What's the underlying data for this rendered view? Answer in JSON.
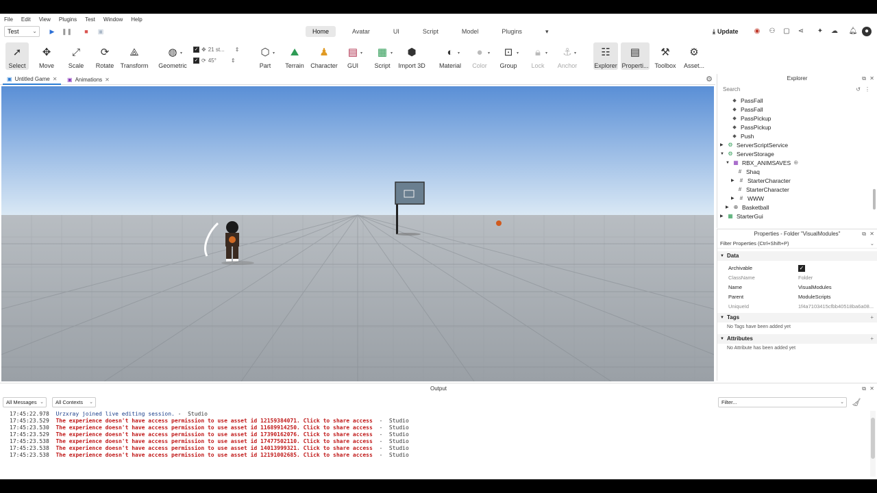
{
  "menu": [
    "File",
    "Edit",
    "View",
    "Plugins",
    "Test",
    "Window",
    "Help"
  ],
  "mode_select": "Test",
  "ribbon_tabs": [
    "Home",
    "Avatar",
    "UI",
    "Script",
    "Model",
    "Plugins"
  ],
  "ribbon_more": "▾",
  "update_label": "Update",
  "toolbar": {
    "select": "Select",
    "move": "Move",
    "scale": "Scale",
    "rotate": "Rotate",
    "transform": "Transform",
    "geometric": "Geometric",
    "snap_move": "21 st...",
    "snap_rotate": "45°",
    "part": "Part",
    "terrain": "Terrain",
    "character": "Character",
    "gui": "GUI",
    "script": "Script",
    "import3d": "Import 3D",
    "material": "Material",
    "color": "Color",
    "group": "Group",
    "lock": "Lock",
    "anchor": "Anchor",
    "explorer": "Explorer",
    "properties": "Properti...",
    "toolbox": "Toolbox",
    "asset": "Asset..."
  },
  "doc_tabs": [
    "Untitled Game",
    "Animations"
  ],
  "explorer": {
    "title": "Explorer",
    "search_placeholder": "Search",
    "items": [
      "PassFall",
      "PassFall",
      "PassPickup",
      "PassPickup",
      "Push",
      "ServerScriptService",
      "ServerStorage",
      "RBX_ANIMSAVES",
      "Shaq",
      "StarterCharacter",
      "StarterCharacter",
      "WWW",
      "Basketball",
      "StarterGui"
    ]
  },
  "properties": {
    "title": "Properties - Folder \"VisualModules\"",
    "filter": "Filter Properties (Ctrl+Shift+P)",
    "section_data": "Data",
    "rows": [
      {
        "name": "Archivable",
        "value": ""
      },
      {
        "name": "ClassName",
        "value": "Folder"
      },
      {
        "name": "Name",
        "value": "VisualModules"
      },
      {
        "name": "Parent",
        "value": "ModuleScripts"
      },
      {
        "name": "UniqueId",
        "value": "1f4a7103415cfbb40518ba6a08..."
      }
    ],
    "section_tags": "Tags",
    "tags_empty": "No Tags have been added yet",
    "section_attributes": "Attributes",
    "attributes_empty": "No Attribute has been added yet"
  },
  "output": {
    "title": "Output",
    "filter_messages": "All Messages",
    "filter_contexts": "All Contexts",
    "filter_placeholder": "Filter...",
    "lines": [
      {
        "ts": "17:45:22.978",
        "msg": "Urzxray joined live editing session.",
        "src": " -  Studio",
        "kind": "info"
      },
      {
        "ts": "17:45:23.529",
        "msg": "The experience doesn't have access permission to use asset id 12159384071. Click to share access",
        "src": "  -  Studio",
        "kind": "err"
      },
      {
        "ts": "17:45:23.530",
        "msg": "The experience doesn't have access permission to use asset id 11689914250. Click to share access",
        "src": "  -  Studio",
        "kind": "err"
      },
      {
        "ts": "17:45:23.529",
        "msg": "The experience doesn't have access permission to use asset id 17390162076. Click to share access",
        "src": "  -  Studio",
        "kind": "err"
      },
      {
        "ts": "17:45:23.538",
        "msg": "The experience doesn't have access permission to use asset id 17477502110. Click to share access",
        "src": "  -  Studio",
        "kind": "err"
      },
      {
        "ts": "17:45:23.538",
        "msg": "The experience doesn't have access permission to use asset id 14013999321. Click to share access",
        "src": "  -  Studio",
        "kind": "err"
      },
      {
        "ts": "17:45:23.538",
        "msg": "The experience doesn't have access permission to use asset id 12191002685. Click to share access",
        "src": "  -  Studio",
        "kind": "err"
      }
    ]
  },
  "colors": {
    "sky_top": "#5a8fd6",
    "sky_bottom": "#dbe9f5",
    "floor": "#a2a8ae",
    "error_text": "#c01818",
    "info_text": "#1a3e8a",
    "accent": "#2b7cd3"
  }
}
